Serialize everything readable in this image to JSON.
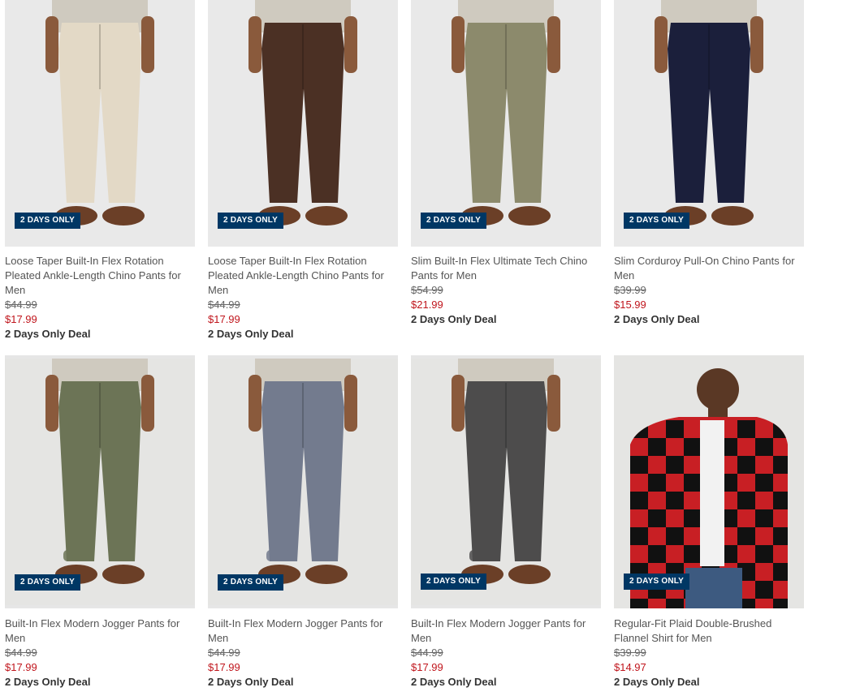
{
  "products": [
    {
      "title": "Loose Taper Built-In Flex Rotation Pleated Ankle-Length Chino Pants for Men",
      "badge": "2 DAYS ONLY",
      "was": "$44.99",
      "now": "$17.99",
      "deal": "2 Days Only Deal",
      "color": "#e3d9c6",
      "bg": "#e9e9e9",
      "kind": "pants"
    },
    {
      "title": "Loose Taper Built-In Flex Rotation Pleated Ankle-Length Chino Pants for Men",
      "badge": "2 DAYS ONLY",
      "was": "$44.99",
      "now": "$17.99",
      "deal": "2 Days Only Deal",
      "color": "#4b3024",
      "bg": "#e9e9e9",
      "kind": "pants"
    },
    {
      "title": "Slim Built-In Flex Ultimate Tech Chino Pants for Men",
      "badge": "2 DAYS ONLY",
      "was": "$54.99",
      "now": "$21.99",
      "deal": "2 Days Only Deal",
      "color": "#8c8a6c",
      "bg": "#e9e9e9",
      "kind": "pants"
    },
    {
      "title": "Slim Corduroy Pull-On Chino Pants for Men",
      "badge": "2 DAYS ONLY",
      "was": "$39.99",
      "now": "$15.99",
      "deal": "2 Days Only Deal",
      "color": "#1b1f3b",
      "bg": "#e9e9e9",
      "kind": "pants"
    },
    {
      "title": "Built-In Flex Modern Jogger Pants for Men",
      "badge": "2 DAYS ONLY",
      "was": "$44.99",
      "now": "$17.99",
      "deal": "2 Days Only Deal",
      "color": "#6c7456",
      "bg": "#e5e5e3",
      "kind": "jogger"
    },
    {
      "title": "Built-In Flex Modern Jogger Pants for Men",
      "badge": "2 DAYS ONLY",
      "was": "$44.99",
      "now": "$17.99",
      "deal": "2 Days Only Deal",
      "color": "#737b8e",
      "bg": "#e5e5e3",
      "kind": "jogger"
    },
    {
      "title": "Built-In Flex Modern Jogger Pants for Men",
      "badge": "2 DAYS ONLY",
      "was": "$44.99",
      "now": "$17.99",
      "deal": "2 Days Only Deal",
      "color": "#4d4c4c",
      "bg": "#e5e5e3",
      "kind": "jogger"
    },
    {
      "title": "Regular-Fit Plaid Double-Brushed Flannel Shirt for Men",
      "badge": "2 DAYS ONLY",
      "was": "$39.99",
      "now": "$14.97",
      "deal": "2 Days Only Deal",
      "color": "#c81f24",
      "bg": "#e5e5e3",
      "kind": "shirt"
    }
  ]
}
